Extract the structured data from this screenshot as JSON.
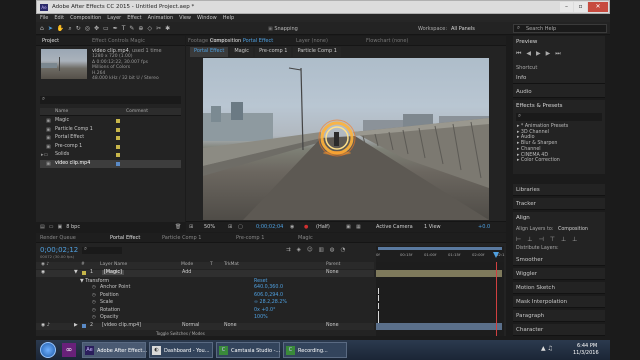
{
  "titlebar": {
    "title": "Adobe After Effects CC 2015 - Untitled Project.aep *"
  },
  "menu": [
    "File",
    "Edit",
    "Composition",
    "Layer",
    "Effect",
    "Animation",
    "View",
    "Window",
    "Help"
  ],
  "toolbar": {
    "snapping": "Snapping",
    "workspace_label": "Workspace:",
    "workspace_value": "All Panels",
    "search": "Search Help"
  },
  "project": {
    "tab": "Project",
    "effect_tab": "Effect Controls Magic",
    "file_name": "video clip.mp4",
    "used": ", used 1 time",
    "info": [
      "1280 x 720 (1.00)",
      "Δ 0:00:12:22, 30.007 fps",
      "Millions of Colors",
      "H.264",
      "48.000 kHz / 32 bit U / Stereo"
    ],
    "col_name": "Name",
    "col_comment": "Comment",
    "items": [
      "Magic",
      "Particle Comp 1",
      "Portal Effect",
      "Pre-comp 1",
      "Solids",
      "video clip.mp4"
    ],
    "bpc": "8 bpc"
  },
  "viewer": {
    "footage": "Footage (none)",
    "comp_label": "Composition",
    "comp_name": "Portal Effect",
    "layer": "Layer (none)",
    "flowchart": "Flowchart (none)",
    "crumbs": [
      "Portal Effect",
      "Magic",
      "Pre-comp 1",
      "Particle Comp 1"
    ],
    "zoom": "50%",
    "timecode": "0;00;02;04",
    "res": "(Half)",
    "camera": "Active Camera",
    "view": "1 View",
    "offset": "+0.0"
  },
  "right_panel": {
    "preview": "Preview",
    "shortcut": "Shortcut",
    "info": "Info",
    "audio": "Audio",
    "effects": "Effects & Presets",
    "effect_list": [
      "* Animation Presets",
      "3D Channel",
      "Audio",
      "Blur & Sharpen",
      "Channel",
      "CINEMA 4D",
      "Color Correction"
    ],
    "libraries": "Libraries",
    "tracker": "Tracker",
    "align": "Align",
    "align_to_label": "Align Layers to:",
    "align_to_value": "Composition",
    "distribute": "Distribute Layers:",
    "smoother": "Smoother",
    "wiggler": "Wiggler",
    "motion_sketch": "Motion Sketch",
    "mask_interp": "Mask Interpolation",
    "paragraph": "Paragraph",
    "character": "Character"
  },
  "timeline": {
    "tabs": [
      "Render Queue",
      "Portal Effect",
      "Particle Comp 1",
      "Pre-comp 1",
      "Magic"
    ],
    "timecode": "0;00;02;12",
    "fps": "00072 (30.00 fps)",
    "cols": {
      "src": "#",
      "layer": "Layer Name",
      "mode": "Mode",
      "t": "T",
      "trkmat": "TrkMat",
      "parent": "Parent"
    },
    "ruler": [
      "0f",
      "00:15f",
      "01:00f",
      "01:15f",
      "02:00f",
      "02:1"
    ],
    "layers": [
      {
        "num": "1",
        "name": "[Magic]",
        "mode": "Add",
        "parent": "None"
      },
      {
        "num": "2",
        "name": "[video clip.mp4]",
        "mode": "Normal",
        "trk": "None",
        "parent": "None"
      }
    ],
    "transform": "Transform",
    "reset": "Reset",
    "props": [
      {
        "name": "Anchor Point",
        "value": "640.0,360.0"
      },
      {
        "name": "Position",
        "value": "606.0,294.0"
      },
      {
        "name": "Scale",
        "value": "∞ 28.2,28.2%"
      },
      {
        "name": "Rotation",
        "value": "0x +0.0°"
      },
      {
        "name": "Opacity",
        "value": "100%"
      }
    ],
    "toggle": "Toggle Switches / Modes"
  },
  "taskbar": {
    "items": [
      "Adobe After Effect...",
      "Dashboard - You...",
      "Camtasia Studio -...",
      "Recording..."
    ],
    "time": "6:44 PM",
    "date": "11/3/2016"
  },
  "colors": {
    "accent": "#4fa0e0",
    "title": "#d9d9d9"
  }
}
